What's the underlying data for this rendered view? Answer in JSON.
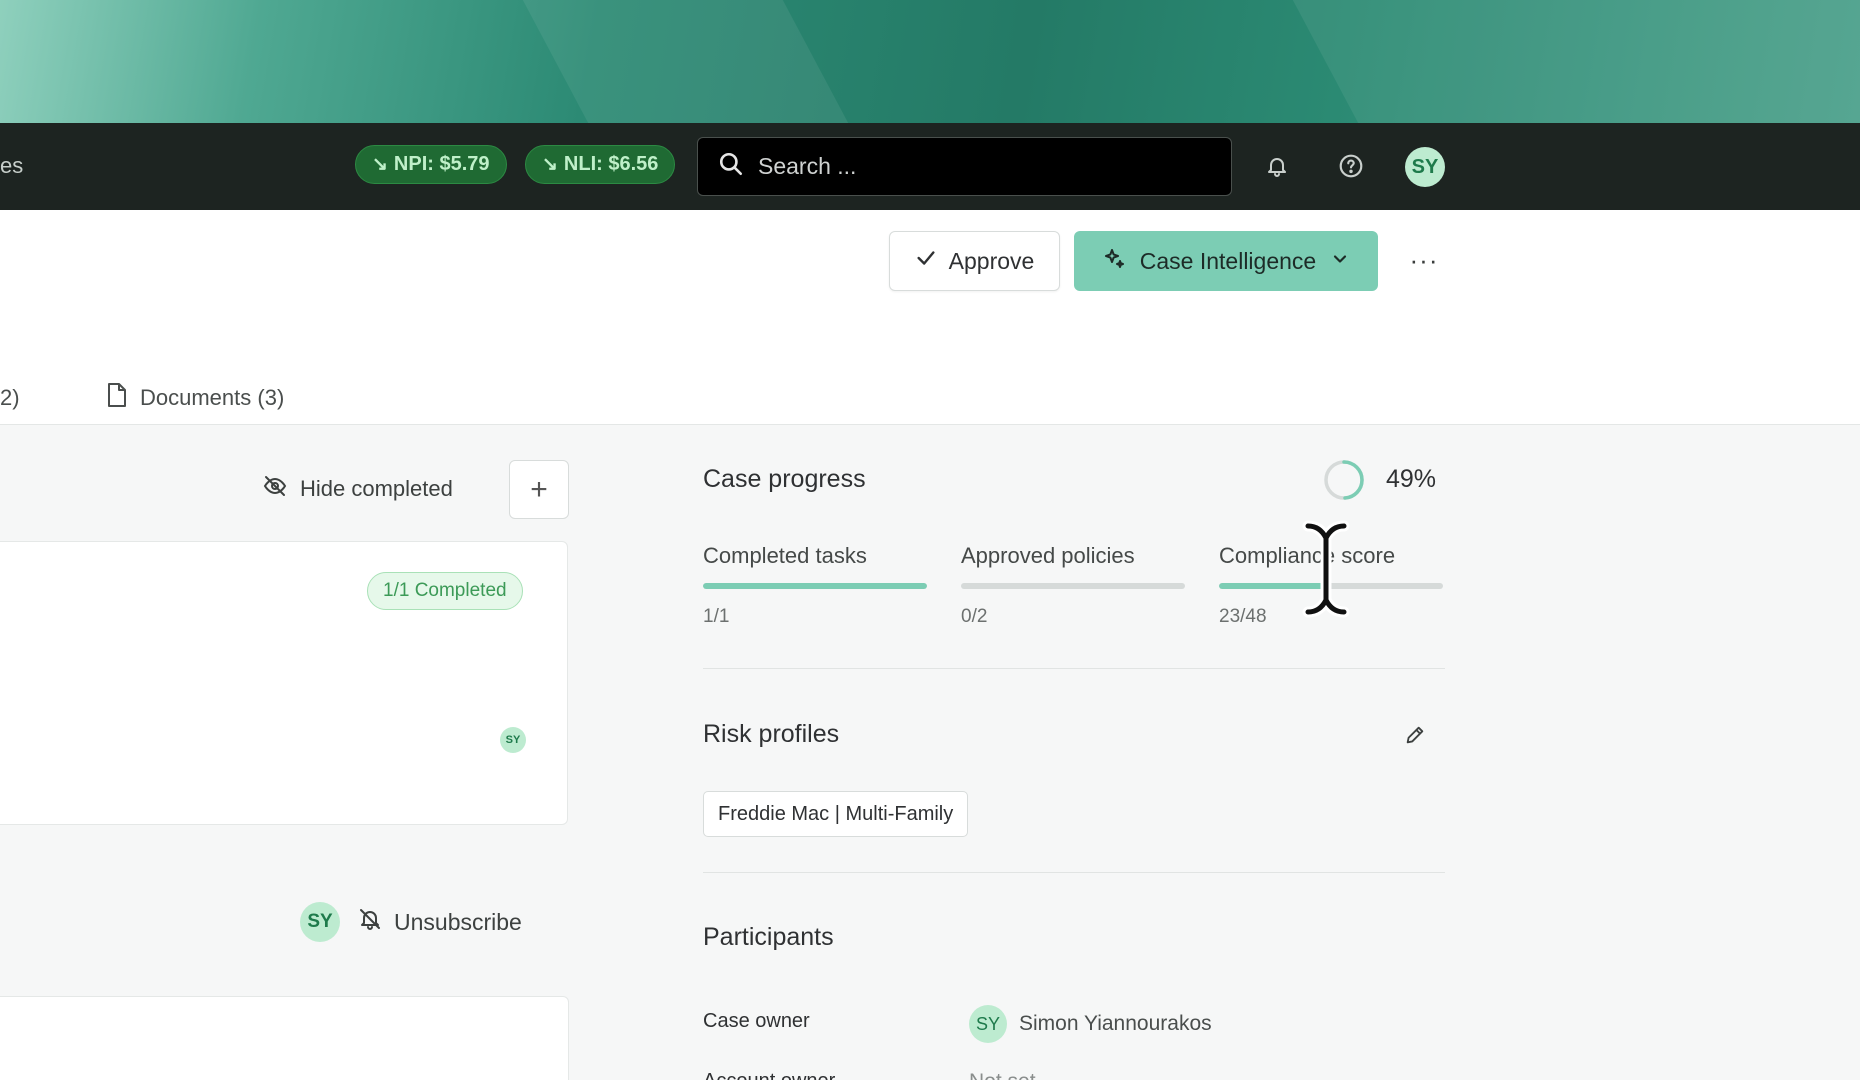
{
  "nav": {
    "partial_label": "es",
    "rates": [
      {
        "label": "NPI: $5.79",
        "trend": "down"
      },
      {
        "label": "NLI: $6.56",
        "trend": "down"
      }
    ],
    "search_placeholder": "Search ...",
    "avatar_initials": "SY"
  },
  "actions": {
    "approve_label": "Approve",
    "case_intelligence_label": "Case Intelligence",
    "more_label": "···"
  },
  "tabs": {
    "partial_label": "2)",
    "documents_label": "Documents (3)"
  },
  "tasks": {
    "hide_completed_label": "Hide completed",
    "add_label": "+",
    "card_badge": "1/1 Completed",
    "card_avatar": "SY",
    "subscriber_avatar": "SY",
    "unsubscribe_label": "Unsubscribe"
  },
  "case_progress": {
    "title": "Case progress",
    "percent_label": "49%",
    "percent": 49,
    "metrics": [
      {
        "label": "Completed tasks",
        "value": "1/1",
        "fill": 1.0
      },
      {
        "label": "Approved policies",
        "value": "0/2",
        "fill": 0.0
      },
      {
        "label": "Compliance score",
        "value": "23/48",
        "fill": 0.479
      }
    ]
  },
  "risk_profiles": {
    "title": "Risk profiles",
    "chips": [
      "Freddie Mac | Multi-Family"
    ]
  },
  "participants": {
    "title": "Participants",
    "case_owner_label": "Case owner",
    "case_owner_avatar": "SY",
    "case_owner_name": "Simon Yiannourakos",
    "account_owner_label": "Account owner",
    "account_owner_value": "Not set"
  },
  "colors": {
    "accent": "#7ccdb4",
    "nav_bg": "#1d2421",
    "rate_pill_bg": "#1f6a33",
    "avatar_bg": "#bdebd0"
  }
}
